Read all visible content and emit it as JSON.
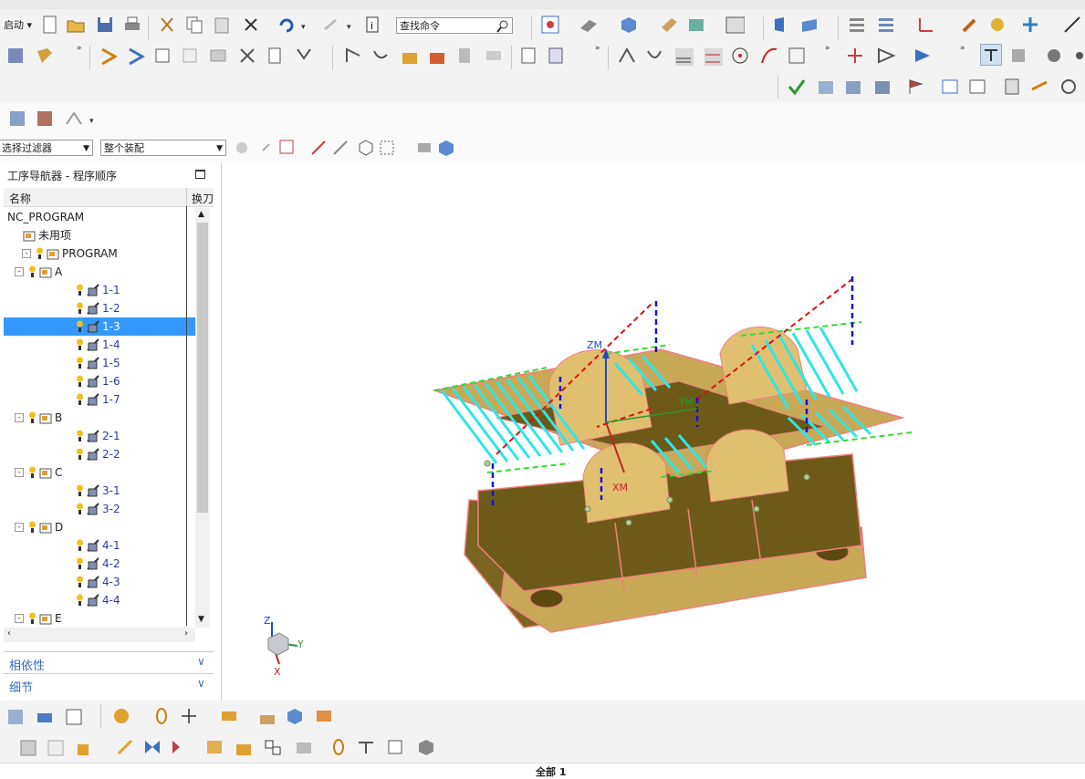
{
  "toolbar": {
    "start_label": "启动",
    "search_placeholder": "查找命令",
    "filter_select": "选择过滤器",
    "assembly_select": "整个装配"
  },
  "navigator": {
    "title": "工序导航器 - 程序顺序",
    "col_name": "名称",
    "col_tool": "换刀",
    "root": "NC_PROGRAM",
    "unused": "未用项",
    "program": "PROGRAM",
    "groups": [
      {
        "name": "A",
        "ops": [
          "1-1",
          "1-2",
          "1-3",
          "1-4",
          "1-5",
          "1-6",
          "1-7"
        ]
      },
      {
        "name": "B",
        "ops": [
          "2-1",
          "2-2"
        ]
      },
      {
        "name": "C",
        "ops": [
          "3-1",
          "3-2"
        ]
      },
      {
        "name": "D",
        "ops": [
          "4-1",
          "4-2",
          "4-3",
          "4-4"
        ]
      },
      {
        "name": "E",
        "ops": []
      }
    ],
    "selected": "1-3",
    "panels": [
      "相依性",
      "细节"
    ]
  },
  "viewport": {
    "axis_zm": "ZM",
    "axis_xm": "XM",
    "axis_ym": "YM",
    "triad_z": "Z",
    "triad_y": "Y",
    "triad_x": "X"
  },
  "status": {
    "text": "全部 1"
  },
  "colors": {
    "selection": "#3399ff",
    "part_fill": "#c8a857",
    "toolpath_cyan": "#2ee6e6",
    "toolpath_green": "#33dd33",
    "engage_red": "#dd1111",
    "retract_blue": "#1111dd"
  }
}
